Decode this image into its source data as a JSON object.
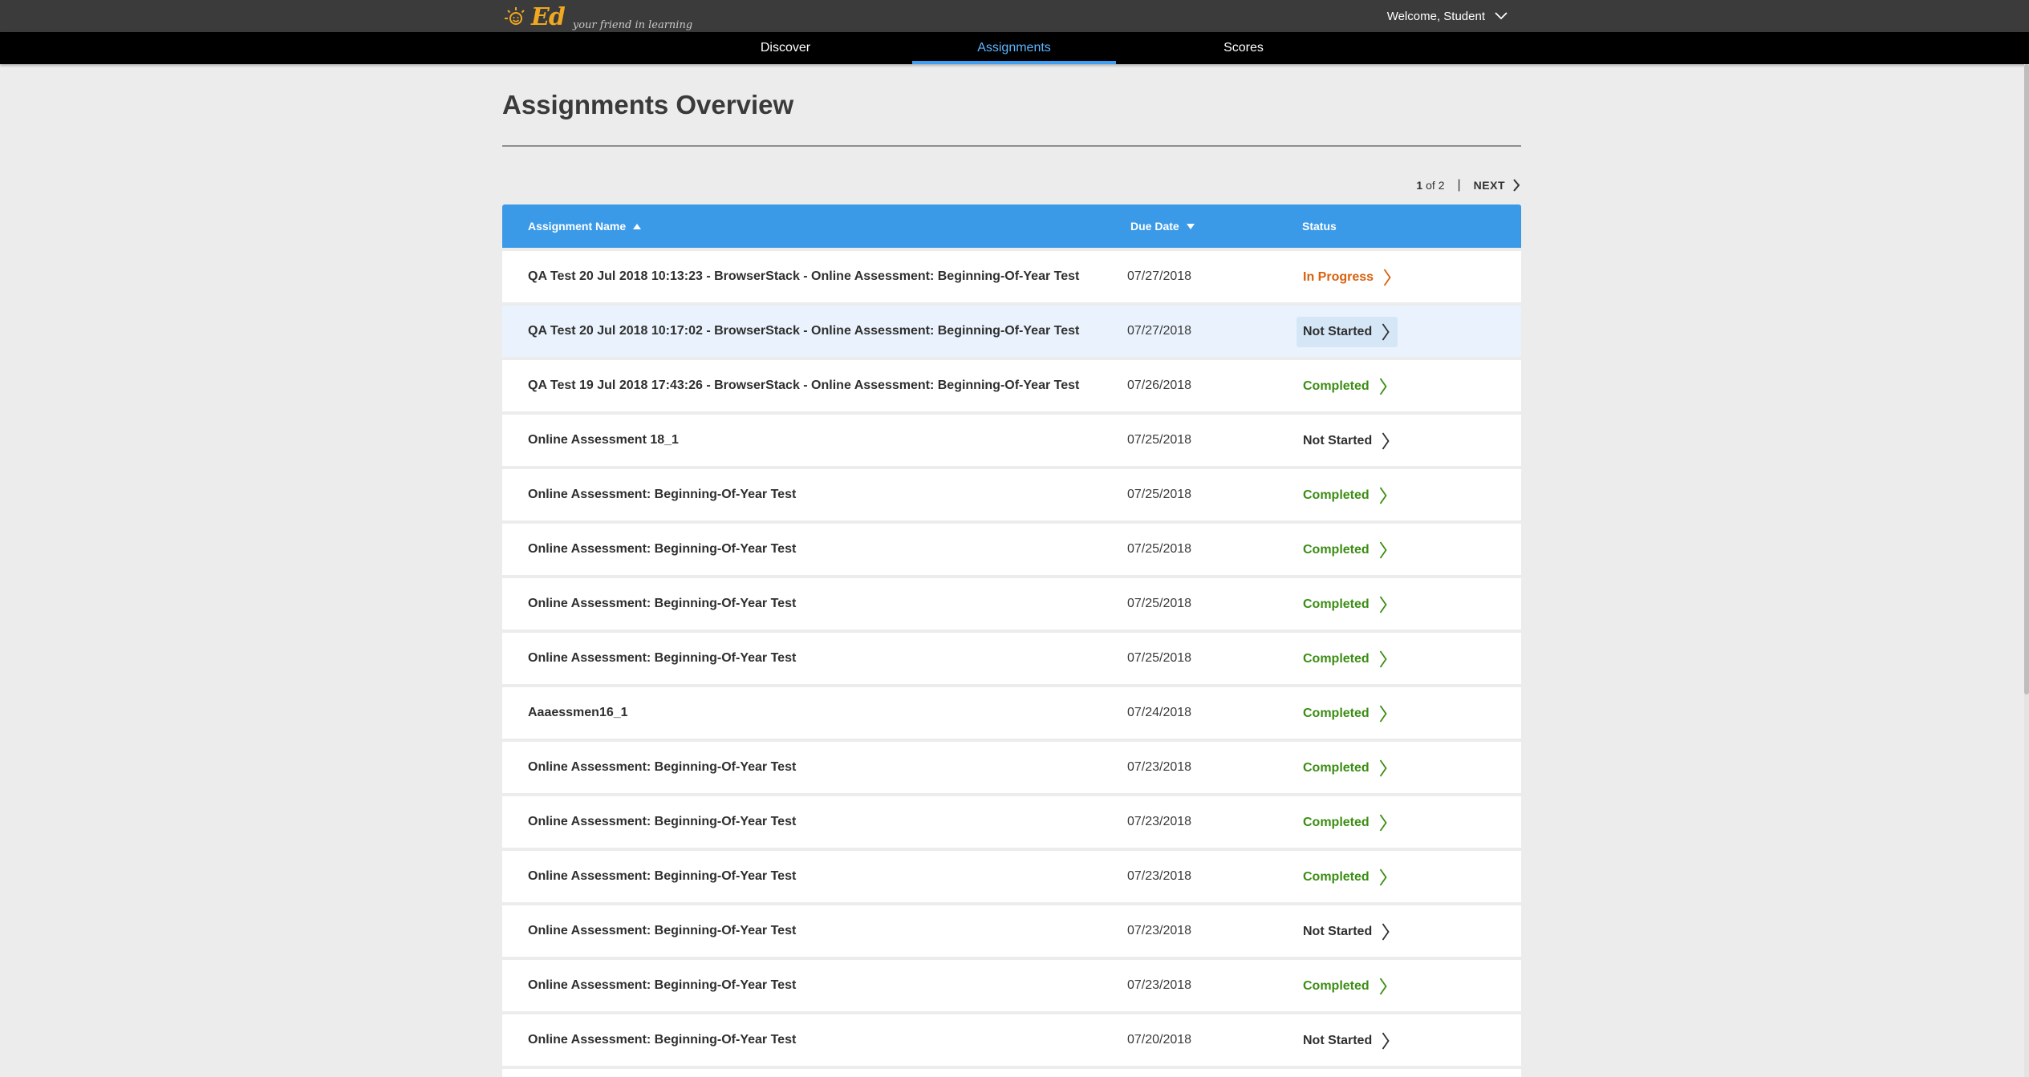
{
  "brand": {
    "logo_text": "Ed",
    "tagline": "your friend in learning"
  },
  "user": {
    "welcome": "Welcome, Student"
  },
  "nav": {
    "tabs": [
      {
        "label": "Discover",
        "active": false
      },
      {
        "label": "Assignments",
        "active": true
      },
      {
        "label": "Scores",
        "active": false
      }
    ]
  },
  "page": {
    "title": "Assignments Overview"
  },
  "pager": {
    "current": "1",
    "of_text": "of 2",
    "separator": "|",
    "next_label": "NEXT"
  },
  "table": {
    "columns": {
      "name": "Assignment Name",
      "due": "Due Date",
      "status": "Status"
    },
    "rows": [
      {
        "name": "QA Test 20 Jul 2018 10:13:23 - BrowserStack - Online Assessment: Beginning-Of-Year Test",
        "due": "07/27/2018",
        "status": "In Progress",
        "kind": "progress",
        "highlight": false
      },
      {
        "name": "QA Test 20 Jul 2018 10:17:02 - BrowserStack - Online Assessment: Beginning-Of-Year Test",
        "due": "07/27/2018",
        "status": "Not Started",
        "kind": "notstarted",
        "highlight": true
      },
      {
        "name": "QA Test 19 Jul 2018 17:43:26 - BrowserStack - Online Assessment: Beginning-Of-Year Test",
        "due": "07/26/2018",
        "status": "Completed",
        "kind": "completed",
        "highlight": false
      },
      {
        "name": "Online Assessment 18_1",
        "due": "07/25/2018",
        "status": "Not Started",
        "kind": "notstarted",
        "highlight": false
      },
      {
        "name": "Online Assessment: Beginning-Of-Year Test",
        "due": "07/25/2018",
        "status": "Completed",
        "kind": "completed",
        "highlight": false
      },
      {
        "name": "Online Assessment: Beginning-Of-Year Test",
        "due": "07/25/2018",
        "status": "Completed",
        "kind": "completed",
        "highlight": false
      },
      {
        "name": "Online Assessment: Beginning-Of-Year Test",
        "due": "07/25/2018",
        "status": "Completed",
        "kind": "completed",
        "highlight": false
      },
      {
        "name": "Online Assessment: Beginning-Of-Year Test",
        "due": "07/25/2018",
        "status": "Completed",
        "kind": "completed",
        "highlight": false
      },
      {
        "name": "Aaaessmen16_1",
        "due": "07/24/2018",
        "status": "Completed",
        "kind": "completed",
        "highlight": false
      },
      {
        "name": "Online Assessment: Beginning-Of-Year Test",
        "due": "07/23/2018",
        "status": "Completed",
        "kind": "completed",
        "highlight": false
      },
      {
        "name": "Online Assessment: Beginning-Of-Year Test",
        "due": "07/23/2018",
        "status": "Completed",
        "kind": "completed",
        "highlight": false
      },
      {
        "name": "Online Assessment: Beginning-Of-Year Test",
        "due": "07/23/2018",
        "status": "Completed",
        "kind": "completed",
        "highlight": false
      },
      {
        "name": "Online Assessment: Beginning-Of-Year Test",
        "due": "07/23/2018",
        "status": "Not Started",
        "kind": "notstarted",
        "highlight": false
      },
      {
        "name": "Online Assessment: Beginning-Of-Year Test",
        "due": "07/23/2018",
        "status": "Completed",
        "kind": "completed",
        "highlight": false
      },
      {
        "name": "Online Assessment: Beginning-Of-Year Test",
        "due": "07/20/2018",
        "status": "Not Started",
        "kind": "notstarted",
        "highlight": false
      },
      {
        "name": "",
        "due": "",
        "status": "",
        "kind": "notstarted",
        "highlight": false
      }
    ]
  },
  "colors": {
    "header_blue": "#3a9ae8",
    "active_tab": "#5cb6ff",
    "in_progress": "#d9600c",
    "completed": "#3b8d13",
    "not_started": "#2f2f2f"
  },
  "icons": {
    "user_menu": "chevron-down-icon",
    "next": "chevron-right-icon",
    "sort_name": "sort-up-icon",
    "sort_due": "sort-down-icon",
    "row_open": "chevron-right-icon"
  }
}
